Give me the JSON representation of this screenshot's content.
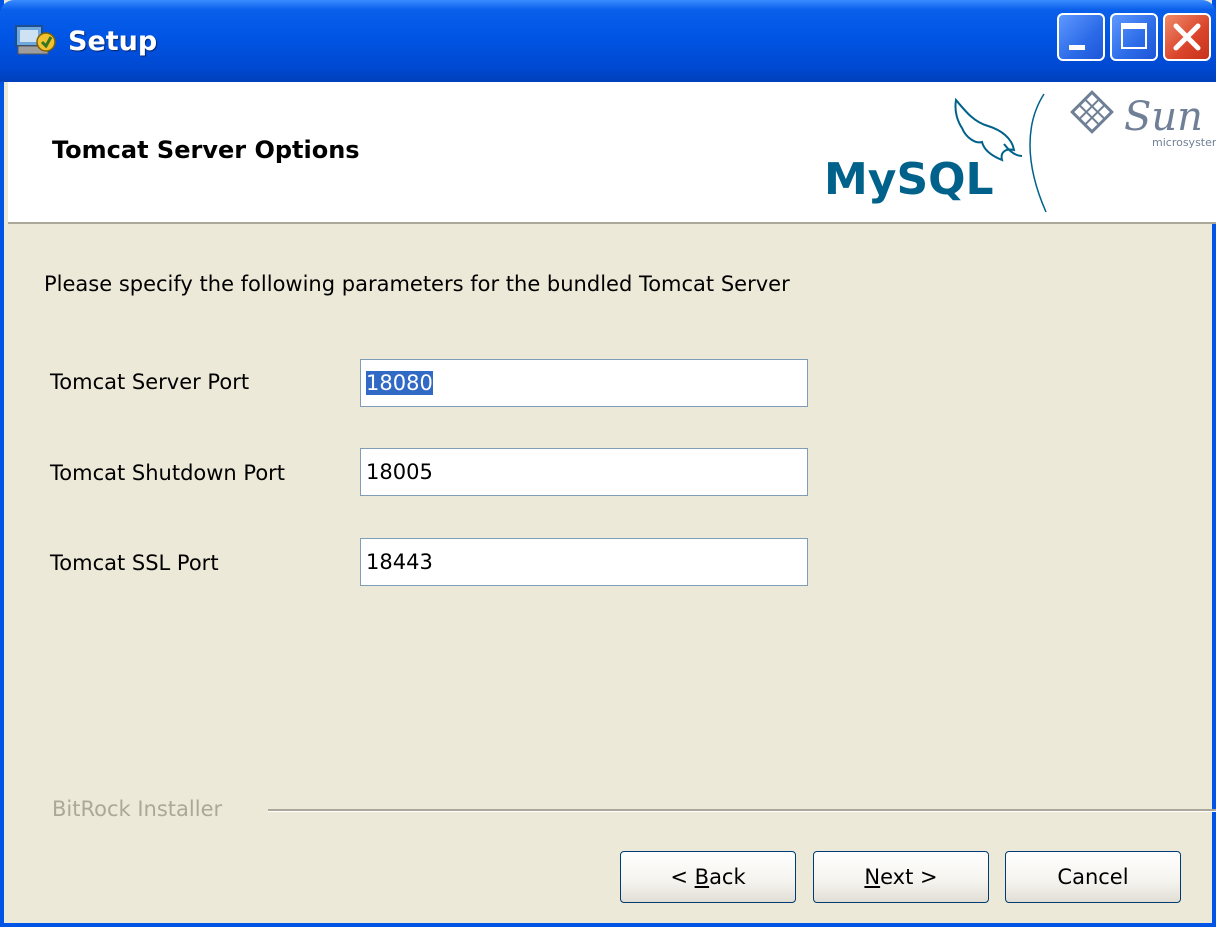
{
  "window": {
    "title": "Setup",
    "controls": [
      "minimize",
      "maximize",
      "close"
    ]
  },
  "header": {
    "title": "Tomcat Server Options",
    "logos": {
      "mysql": "MySQL",
      "sun": "Sun",
      "sun_sub": "microsystems"
    }
  },
  "main": {
    "intro": "Please specify the following parameters for the bundled Tomcat Server",
    "fields": [
      {
        "label": "Tomcat Server Port",
        "value": "18080",
        "selected": true
      },
      {
        "label": "Tomcat Shutdown Port",
        "value": "18005"
      },
      {
        "label": "Tomcat SSL Port",
        "value": "18443"
      }
    ]
  },
  "footer": {
    "installer_label": "BitRock Installer",
    "buttons": {
      "back": {
        "prefix": "< ",
        "accel": "B",
        "rest": "ack"
      },
      "next": {
        "accel": "N",
        "rest": "ext >"
      },
      "cancel": "Cancel"
    }
  },
  "colors": {
    "titlebar": "#0055E5",
    "dialog_bg": "#ECE9D8",
    "selection": "#316AC5",
    "mysql_blue": "#00618A",
    "mysql_orange": "#E48E00"
  }
}
